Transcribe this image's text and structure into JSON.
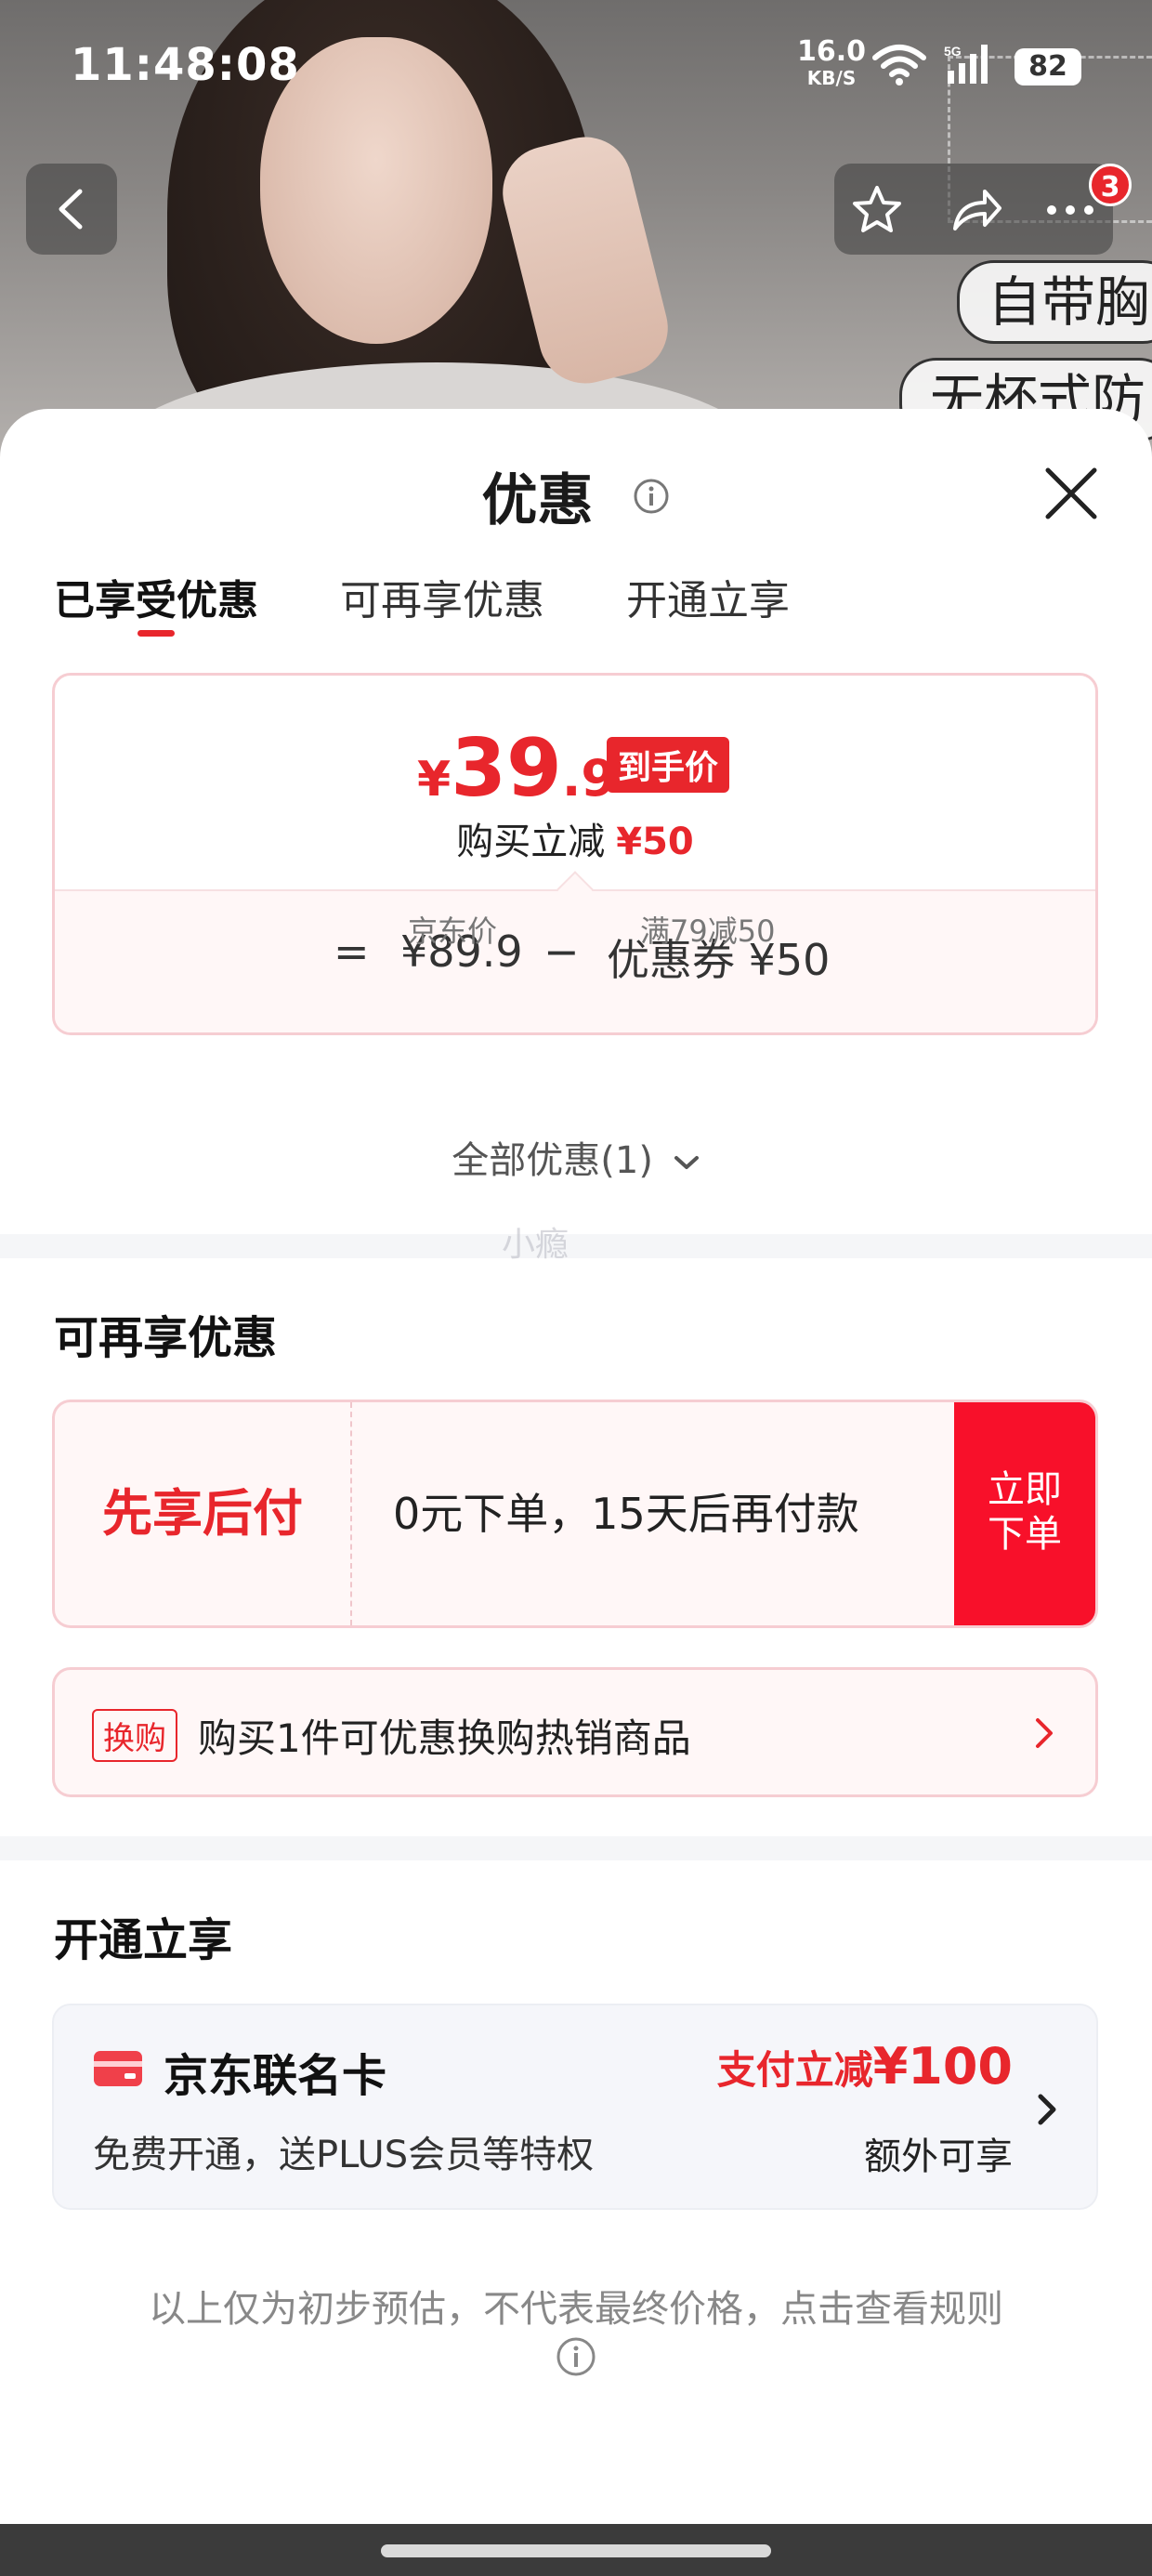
{
  "status_bar": {
    "time": "11:48:08",
    "net_speed_value": "16.0",
    "net_speed_unit": "KB/S",
    "network_type": "5G",
    "battery": "82"
  },
  "header": {
    "notification_count": "3",
    "photo_tags": [
      "自带胸",
      "无杯式防"
    ]
  },
  "sheet": {
    "title": "优惠",
    "tabs": [
      "已享受优惠",
      "可再享优惠",
      "开通立享"
    ],
    "active_tab": 0
  },
  "price_card": {
    "yen": "¥",
    "price_int": "39",
    "price_dec": ".9",
    "final_badge": "到手价",
    "discount_label": "购买立减",
    "discount_amount": "¥50",
    "eq": "=",
    "jd_price": "¥89.9",
    "minus": "−",
    "coupon": "优惠券 ¥50",
    "jd_price_label": "京东价",
    "coupon_rule": "满79减50"
  },
  "all_deals": "全部优惠(1)",
  "watermark": "小瘾",
  "more_deals": {
    "title": "可再享优惠",
    "bnpl_name": "先享后付",
    "bnpl_desc": "0元下单，15天后再付款",
    "bnpl_button": [
      "立即",
      "下单"
    ],
    "swap_tag": "换购",
    "swap_text": "购买1件可优惠换购热销商品"
  },
  "open_now": {
    "title": "开通立享",
    "card_name": "京东联名卡",
    "card_desc": "免费开通，送PLUS会员等特权",
    "pay_label": "支付立减",
    "pay_amount": "¥100",
    "extra": "额外可享"
  },
  "footnote": "以上仅为初步预估，不代表最终价格，点击查看规则",
  "colors": {
    "accent": "#e8262c",
    "button_red": "#f8102a",
    "card_border": "#f6cdd2"
  }
}
